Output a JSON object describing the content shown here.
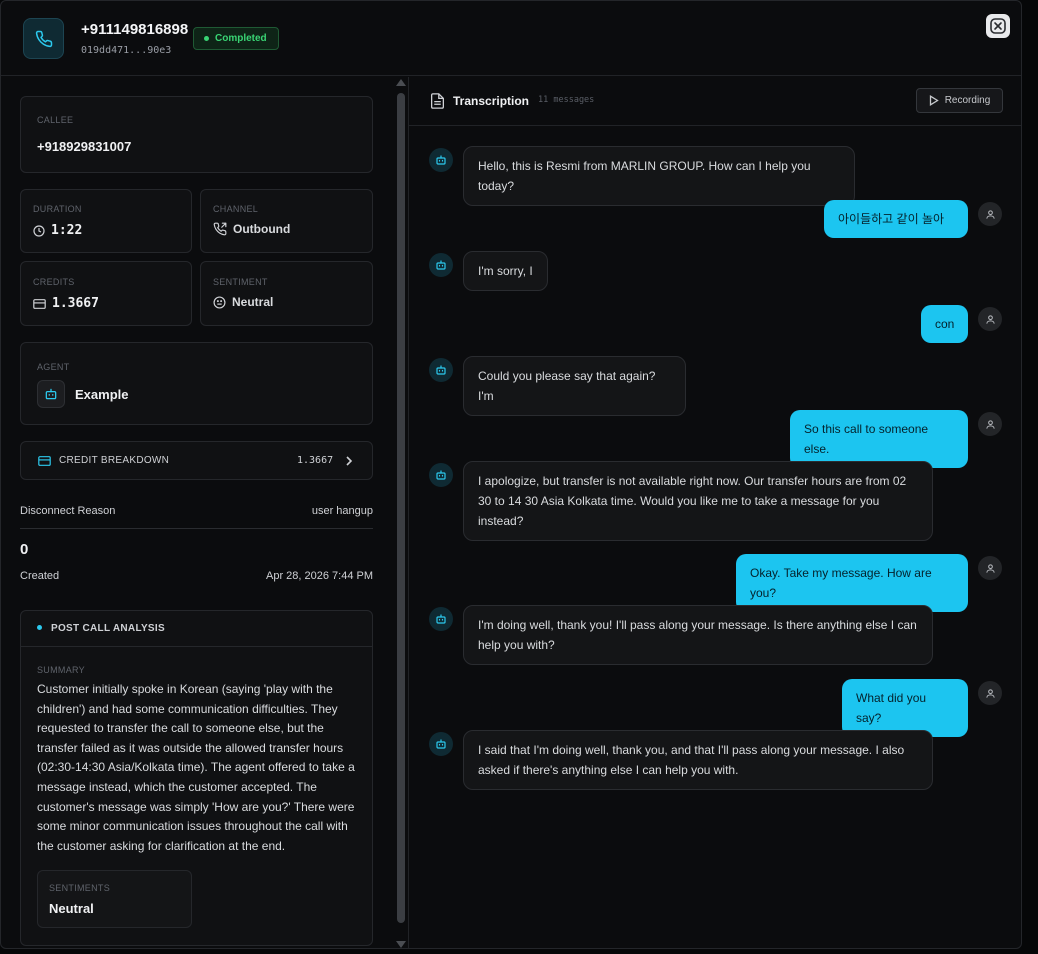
{
  "header": {
    "phone_number": "+911149816898",
    "call_id": "019dd471...90e3",
    "status": "Completed",
    "status_color": "#39d474"
  },
  "details": {
    "callee_label": "CALLEE",
    "callee_value": "+918929831007",
    "duration_label": "DURATION",
    "duration_value": "1:22",
    "channel_label": "CHANNEL",
    "channel_value": "Outbound",
    "credits_label": "CREDITS",
    "credits_value": "1.3667",
    "sentiment_label": "SENTIMENT",
    "sentiment_value": "Neutral",
    "agent_label": "AGENT",
    "agent_value": "Example",
    "credit_breakdown_label": "CREDIT BREAKDOWN",
    "credit_breakdown_value": "1.3667",
    "disconnect_reason_label": "Disconnect Reason",
    "disconnect_reason_value": "user hangup",
    "count_value": "0",
    "created_label": "Created",
    "created_value": "Apr 28, 2026 7:44 PM"
  },
  "analysis": {
    "title": "POST CALL ANALYSIS",
    "summary_label": "SUMMARY",
    "summary_text": "Customer initially spoke in Korean (saying 'play with the children') and had some communication difficulties. They requested to transfer the call to someone else, but the transfer failed as it was outside the allowed transfer hours (02:30-14:30 Asia/Kolkata time). The agent offered to take a message instead, which the customer accepted. The customer's message was simply 'How are you?' There were some minor communication issues throughout the call with the customer asking for clarification at the end.",
    "sentiments_label": "SENTIMENTS",
    "sentiments_value": "Neutral"
  },
  "transcription": {
    "title": "Transcription",
    "count": "11 messages",
    "recording_label": "Recording",
    "accent_color": "#1cc5f0",
    "messages": [
      {
        "role": "agent",
        "text": "Hello, this is Resmi from MARLIN GROUP. How can I help you today?"
      },
      {
        "role": "user",
        "text": "아이들하고 같이 놀아"
      },
      {
        "role": "agent",
        "text": "I'm sorry, I"
      },
      {
        "role": "user",
        "text": "con"
      },
      {
        "role": "agent",
        "text": "Could you please say that again? I'm"
      },
      {
        "role": "user",
        "text": "So this call to someone else."
      },
      {
        "role": "agent",
        "text": "I apologize, but transfer is not available right now. Our transfer hours are from 02 30 to 14 30 Asia Kolkata time. Would you like me to take a message for you instead?"
      },
      {
        "role": "user",
        "text": "Okay. Take my message. How are you?"
      },
      {
        "role": "agent",
        "text": "I'm doing well, thank you! I'll pass along your message. Is there anything else I can help you with?"
      },
      {
        "role": "user",
        "text": "What did you say?"
      },
      {
        "role": "agent",
        "text": "I said that I'm doing well, thank you, and that I'll pass along your message. I also asked if there's anything else I can help you with."
      }
    ]
  }
}
